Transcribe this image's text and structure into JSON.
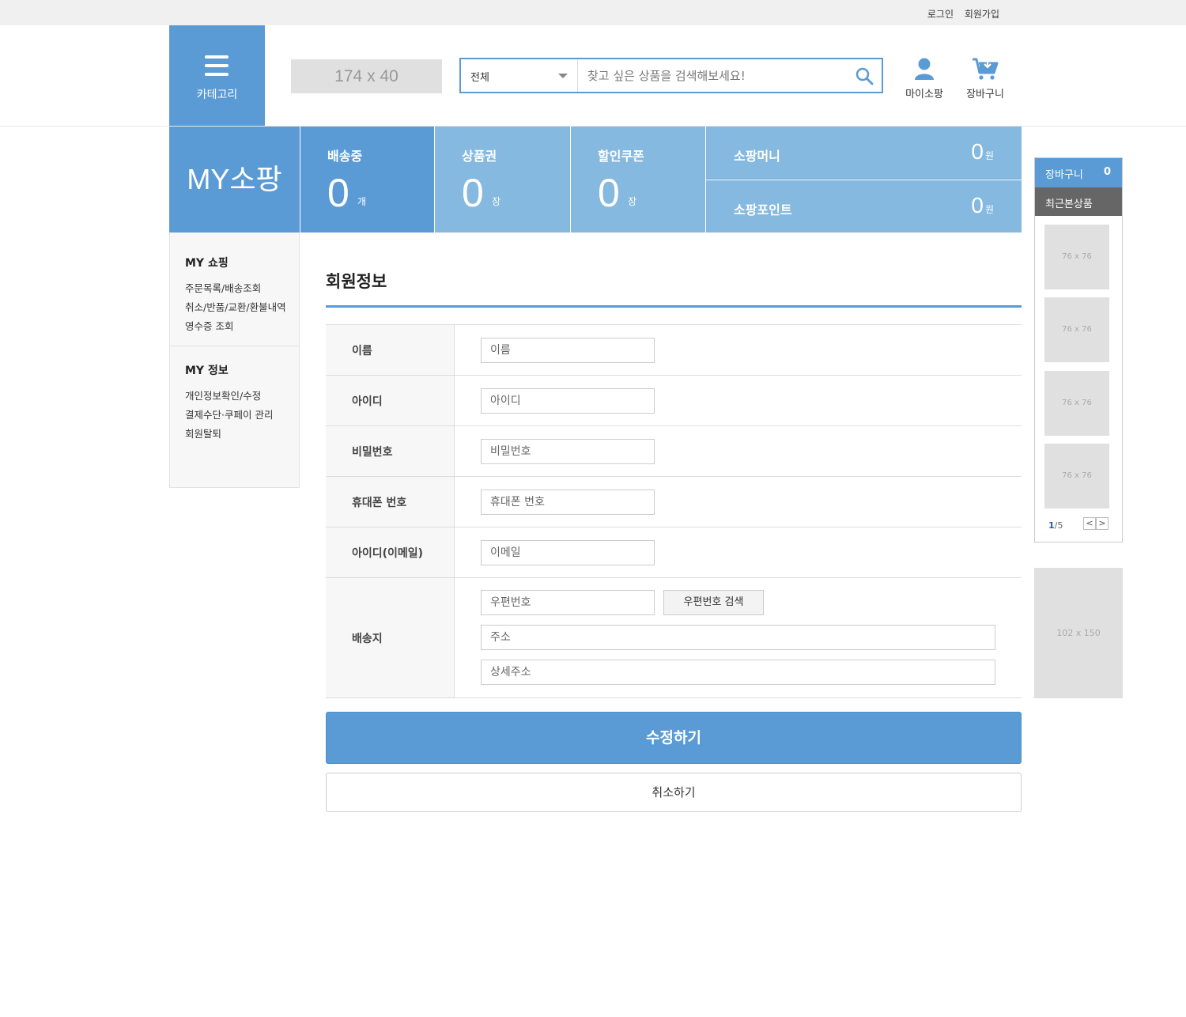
{
  "topbar": {
    "login": "로그인",
    "signup": "회원가입"
  },
  "header": {
    "category_label": "카테고리",
    "logo_placeholder": "174 x 40",
    "search_select": "전체",
    "search_placeholder": "찾고 싶은 상품을 검색해보세요!",
    "mypage_label": "마이소팡",
    "cart_label": "장바구니"
  },
  "banner": {
    "title": "MY소팡",
    "stats": [
      {
        "label": "배송중",
        "value": "0",
        "unit": "개"
      },
      {
        "label": "상품권",
        "value": "0",
        "unit": "장"
      },
      {
        "label": "할인쿠폰",
        "value": "0",
        "unit": "장"
      }
    ],
    "money": {
      "label": "소팡머니",
      "value": "0",
      "unit": "원"
    },
    "point": {
      "label": "소팡포인트",
      "value": "0",
      "unit": "원"
    }
  },
  "sidebar": {
    "groups": [
      {
        "title": "MY 쇼핑",
        "items": [
          "주문목록/배송조회",
          "취소/반품/교환/환불내역",
          "영수증 조회"
        ]
      },
      {
        "title": "MY 정보",
        "items": [
          "개인정보확인/수정",
          "결제수단·쿠페이 관리",
          "회원탈퇴"
        ]
      }
    ]
  },
  "form": {
    "title": "회원정보",
    "rows": [
      {
        "label": "이름",
        "placeholder": "이름"
      },
      {
        "label": "아이디",
        "placeholder": "아이디"
      },
      {
        "label": "비밀번호",
        "placeholder": "비밀번호"
      },
      {
        "label": "휴대폰 번호",
        "placeholder": "휴대폰 번호"
      },
      {
        "label": "아이디(이메일)",
        "placeholder": "이메일"
      }
    ],
    "address": {
      "label": "배송지",
      "zip_placeholder": "우편번호",
      "zip_button": "우편번호 검색",
      "addr_placeholder": "주소",
      "detail_placeholder": "상세주소"
    },
    "save_button": "수정하기",
    "cancel_button": "취소하기"
  },
  "quick": {
    "cart_label": "장바구니",
    "cart_count": "0",
    "recent_label": "최근본상품",
    "thumbs": [
      "76 x 76",
      "76 x 76",
      "76 x 76",
      "76 x 76"
    ],
    "page_current": "1",
    "page_total": "/5",
    "prev": "<",
    "next": ">",
    "ad_placeholder": "102 x 150"
  },
  "colors": {
    "accent": "#5b9bd5",
    "accent_light": "#85b9e0",
    "recent_bg": "#666666"
  }
}
